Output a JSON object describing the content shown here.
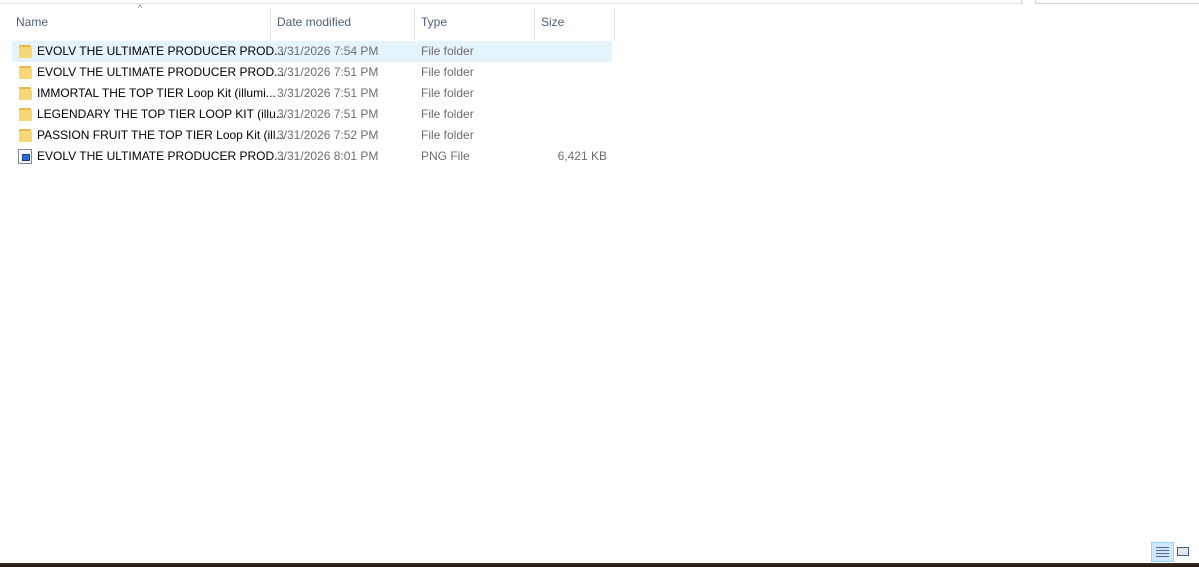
{
  "columns": {
    "name": "Name",
    "date_modified": "Date modified",
    "type": "Type",
    "size": "Size"
  },
  "sort_indicator": "^",
  "files": [
    {
      "name": "EVOLV THE ULTIMATE PRODUCER PROD...",
      "date": "3/31/2026 7:54 PM",
      "type": "File folder",
      "size": "",
      "icon": "folder-icon",
      "selected": true
    },
    {
      "name": "EVOLV THE ULTIMATE PRODUCER PROD...",
      "date": "3/31/2026 7:51 PM",
      "type": "File folder",
      "size": "",
      "icon": "folder-icon",
      "selected": false
    },
    {
      "name": "IMMORTAL THE TOP TIER Loop Kit (illumi...",
      "date": "3/31/2026 7:51 PM",
      "type": "File folder",
      "size": "",
      "icon": "folder-icon",
      "selected": false
    },
    {
      "name": "LEGENDARY THE TOP TIER LOOP KIT (illu...",
      "date": "3/31/2026 7:51 PM",
      "type": "File folder",
      "size": "",
      "icon": "folder-icon",
      "selected": false
    },
    {
      "name": "PASSION FRUIT THE TOP TIER Loop Kit (ill...",
      "date": "3/31/2026 7:52 PM",
      "type": "File folder",
      "size": "",
      "icon": "folder-icon",
      "selected": false
    },
    {
      "name": "EVOLV THE ULTIMATE PRODUCER PROD...",
      "date": "3/31/2026 8:01 PM",
      "type": "PNG File",
      "size": "6,421 KB",
      "icon": "png-file-icon",
      "selected": false
    }
  ],
  "view_buttons": {
    "details": "details-view-icon",
    "large_icons": "large-icons-view-icon"
  },
  "colors": {
    "selection": "#e5f3fb",
    "header_text": "#4c607a",
    "folder": "#f8d775"
  }
}
